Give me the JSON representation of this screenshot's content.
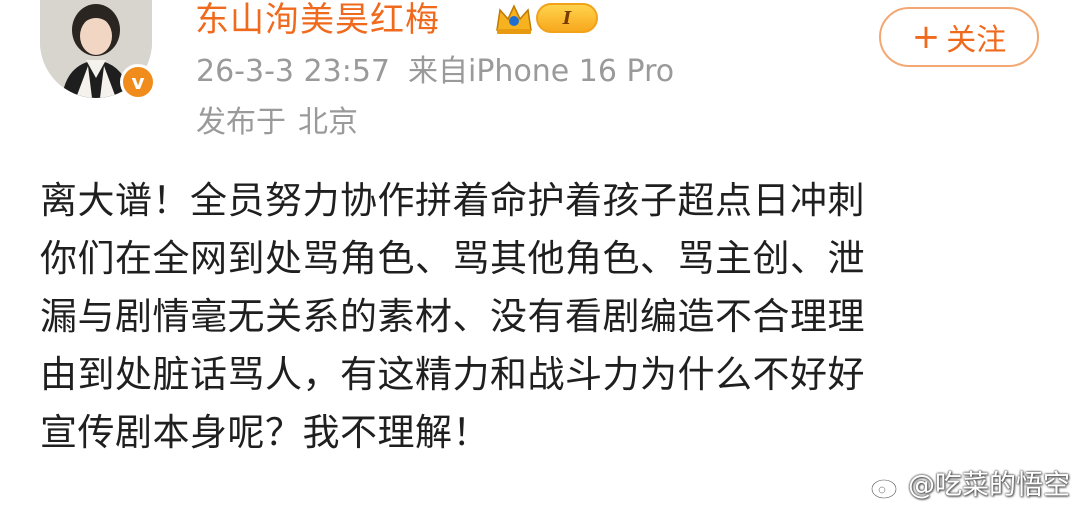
{
  "user": {
    "name": "东山洵美昊红梅",
    "verified_mark": "v",
    "level_badge": "I",
    "avatar_icon": "avatar-photo",
    "crown_icon": "crown-icon"
  },
  "meta": {
    "timestamp": "26-3-3 23:57",
    "source": "来自iPhone 16 Pro",
    "location_prefix": "发布于",
    "location": "北京"
  },
  "follow_button": {
    "icon": "+",
    "label": "关注"
  },
  "post": {
    "lines": [
      "离大谱！全员努力协作拼着命护着孩子超点日冲刺",
      "你们在全网到处骂角色、骂其他角色、骂主创、泄",
      "漏与剧情毫无关系的素材、没有看剧编造不合理理",
      "由到处脏话骂人，有这精力和战斗力为什么不好好",
      "宣传剧本身呢？我不理解！"
    ]
  },
  "watermark": {
    "text": "@吃菜的悟空",
    "icon": "weibo-icon"
  },
  "colors": {
    "accent": "#f06a1d",
    "meta_gray": "#9a9a9a",
    "verified_orange": "#f08c1c"
  }
}
